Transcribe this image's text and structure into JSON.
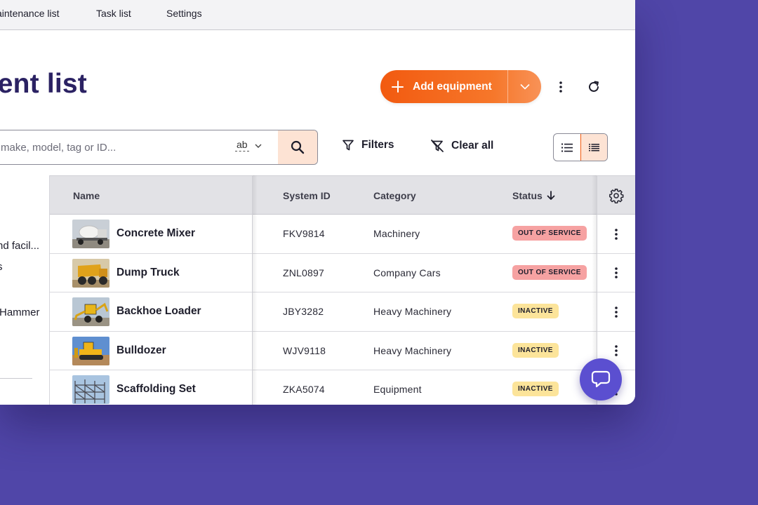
{
  "colors": {
    "background": "#5046a8",
    "title": "#2b2263",
    "accent": "#f25a10",
    "accent_soft": "#fde3d4",
    "badge_out_of_service": "#f6a2a2",
    "badge_inactive": "#fce49a",
    "chat": "#5b4fd0"
  },
  "nav": {
    "items": [
      {
        "label": "aintenance list"
      },
      {
        "label": "Task list"
      },
      {
        "label": "Settings"
      }
    ]
  },
  "header": {
    "title": "ent list",
    "add_button_label": "Add equipment",
    "add_icon": "plus-icon",
    "caret_icon": "chevron-down-icon",
    "more_icon": "more-vertical-icon",
    "refresh_icon": "refresh-icon"
  },
  "search": {
    "placeholder": "make, model, tag or ID...",
    "value": "",
    "match_mode_label": "ab",
    "search_icon": "search-icon"
  },
  "toolbar": {
    "filters_label": "Filters",
    "clear_all_label": "Clear all",
    "filter_icon": "filter-icon",
    "clear_filter_icon": "filter-off-icon",
    "view_modes": [
      "list-icon",
      "compact-list-icon"
    ],
    "active_view": "compact-list-icon"
  },
  "left_panel": {
    "items": [
      "nd facil...",
      "s",
      "Hammer"
    ]
  },
  "table": {
    "columns": {
      "name": "Name",
      "system_id": "System ID",
      "category": "Category",
      "status": "Status"
    },
    "sort_icon": "arrow-down-icon",
    "settings_icon": "gear-icon",
    "rows": [
      {
        "name": "Concrete Mixer",
        "thumb": "concrete-mixer-photo",
        "system_id": "FKV9814",
        "category": "Machinery",
        "status": "OUT OF SERVICE",
        "status_kind": "oos"
      },
      {
        "name": "Dump Truck",
        "thumb": "dump-truck-photo",
        "system_id": "ZNL0897",
        "category": "Company Cars",
        "status": "OUT OF SERVICE",
        "status_kind": "oos"
      },
      {
        "name": "Backhoe Loader",
        "thumb": "backhoe-loader-photo",
        "system_id": "JBY3282",
        "category": "Heavy Machinery",
        "status": "INACTIVE",
        "status_kind": "inactive"
      },
      {
        "name": "Bulldozer",
        "thumb": "bulldozer-photo",
        "system_id": "WJV9118",
        "category": "Heavy Machinery",
        "status": "INACTIVE",
        "status_kind": "inactive"
      },
      {
        "name": "Scaffolding Set",
        "thumb": "scaffolding-photo",
        "system_id": "ZKA5074",
        "category": "Equipment",
        "status": "INACTIVE",
        "status_kind": "inactive"
      }
    ]
  },
  "chat": {
    "icon": "chat-bubble-icon"
  }
}
